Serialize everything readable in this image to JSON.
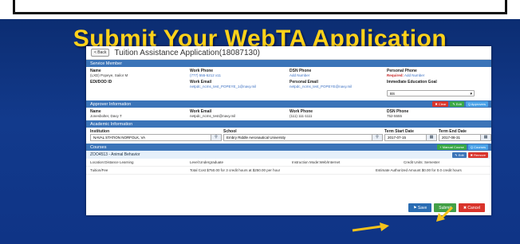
{
  "slide": {
    "title": "Submit Your WebTA Application"
  },
  "app": {
    "back_label": "< Back",
    "title": "Tuition Assistance Application(18087130)"
  },
  "service_member": {
    "section_label": "Service Member",
    "name_label": "Name",
    "name_value": "(LXD) Popeye, Sailor M",
    "work_phone_label": "Work Phone",
    "work_phone_value": "(777) 555-5212 x11",
    "dsn_phone_label": "DSN Phone",
    "dsn_phone_value": "Add Number",
    "personal_phone_label": "Personal Phone",
    "personal_phone_required": "Required:",
    "personal_phone_value": "Add Number",
    "edipi_label": "EDI/DOD ID",
    "work_email_label": "Work Email",
    "work_email_value": "netpdc_ncms_test_POPEYE_1@navy.mil",
    "personal_email_label": "Personal Email",
    "personal_email_value": "netpdc_ncms_test_POPEYE@navy.mil",
    "edu_goal_label": "Immediate Education Goal",
    "edu_goal_value": "BS"
  },
  "approver": {
    "section_label": "Approver Information",
    "btn_clear": "✖ Clear",
    "btn_edit": "✎ Edit",
    "btn_approvers": "Q Approvers",
    "name_label": "Name",
    "name_value": "Jonesbolter, Davy T",
    "work_email_label": "Work Email",
    "work_email_value": "netpdc_ncms_test@navy.mil",
    "work_phone_label": "Work Phone",
    "work_phone_value": "(111) 111-1111",
    "dsn_phone_label": "DSN Phone",
    "dsn_phone_value": "752-5555"
  },
  "academic": {
    "section_label": "Academic Information",
    "institution_label": "Institution",
    "institution_value": "NAVAL STATION NORFOLK, VA",
    "school_label": "School",
    "school_value": "Embry Riddle Aeronautical University",
    "start_label": "Term Start Date",
    "start_value": "2017-07-15",
    "end_label": "Term End Date",
    "end_value": "2017-08-31"
  },
  "courses": {
    "section_label": "Courses",
    "btn_manual": "+ Manual Course",
    "btn_courses": "Q Courses",
    "course_title": "ZOO4513 - Animal Behavior",
    "btn_edit": "✎ Edit",
    "btn_remove": "✖ Remove",
    "location": "Location:Distance Learning",
    "level": "Level:Undergraduate",
    "mode": "Instruction Mode:Web/Internet",
    "credit_units": "Credit Units: Semester",
    "tuition_fee": "Tuition/Fee",
    "total_cost": "Total Cost $750.00 for 3 credit hours at $250.00 per hour",
    "estimate": "Estimate Authorized Amount $0.00 for 0.0 credit hours"
  },
  "footer": {
    "save_label": "⚑ Save",
    "submit_label": "Submit",
    "cancel_label": "✖ Cancel"
  },
  "colors": {
    "slide_bg": "#123a8c",
    "title": "#ffd21a",
    "section_bar": "#3b74b8",
    "arrow": "#f4c21b"
  }
}
